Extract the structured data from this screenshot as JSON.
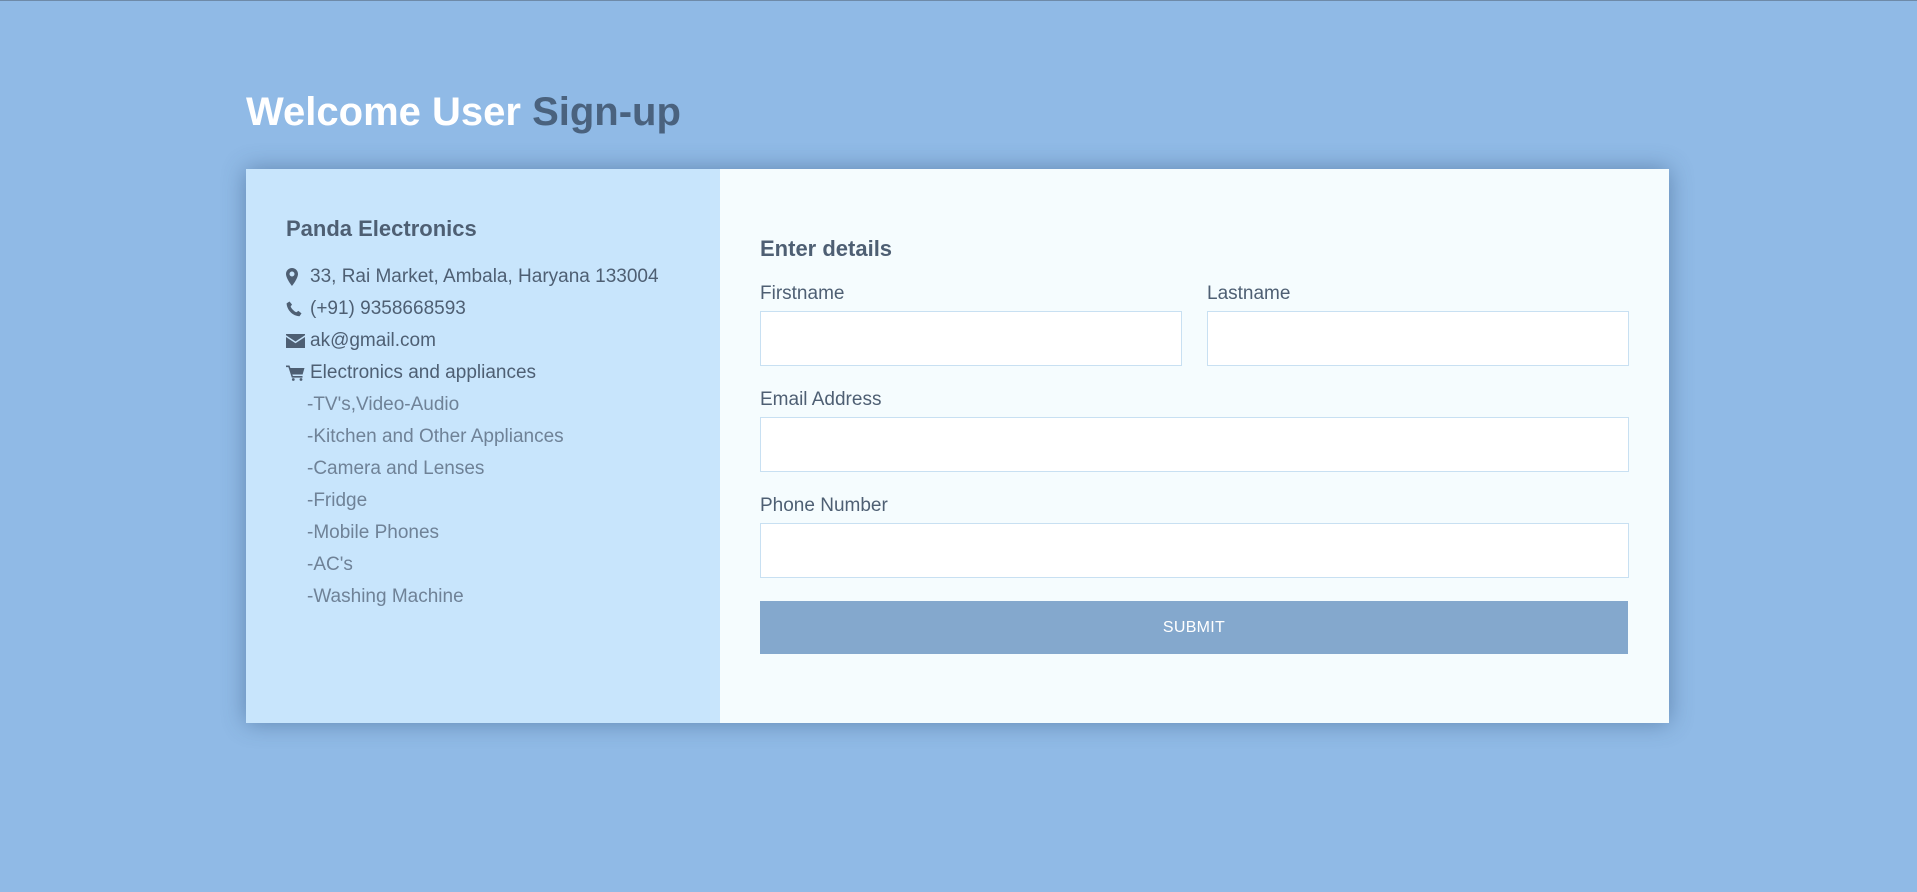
{
  "header": {
    "welcome_text": "Welcome User",
    "signup_text": "Sign-up"
  },
  "company": {
    "name": "Panda Electronics",
    "address": "33, Rai Market, Ambala, Haryana 133004",
    "phone": "(+91) 9358668593",
    "email": "ak@gmail.com",
    "category_heading": "Electronics and appliances",
    "categories": [
      "-TV's,Video-Audio",
      "-Kitchen and Other Appliances",
      "-Camera and Lenses",
      "-Fridge",
      "-Mobile Phones",
      "-AC's",
      "-Washing Machine"
    ],
    "icons": {
      "address": "map-marker-icon",
      "phone": "phone-icon",
      "email": "envelope-icon",
      "category": "shopping-cart-icon"
    }
  },
  "form": {
    "title": "Enter details",
    "firstname": {
      "label": "Firstname",
      "value": "",
      "placeholder": ""
    },
    "lastname": {
      "label": "Lastname",
      "value": "",
      "placeholder": ""
    },
    "email": {
      "label": "Email Address",
      "value": "",
      "placeholder": ""
    },
    "phone": {
      "label": "Phone Number",
      "value": "",
      "placeholder": ""
    },
    "submit_label": "SUBMIT"
  },
  "colors": {
    "background": "#90bae6",
    "info_panel": "#c8e5fc",
    "form_panel": "#f5fcfe",
    "heading_dark": "#4a627e",
    "text": "#4e5f73",
    "button": "#84a8cd"
  }
}
